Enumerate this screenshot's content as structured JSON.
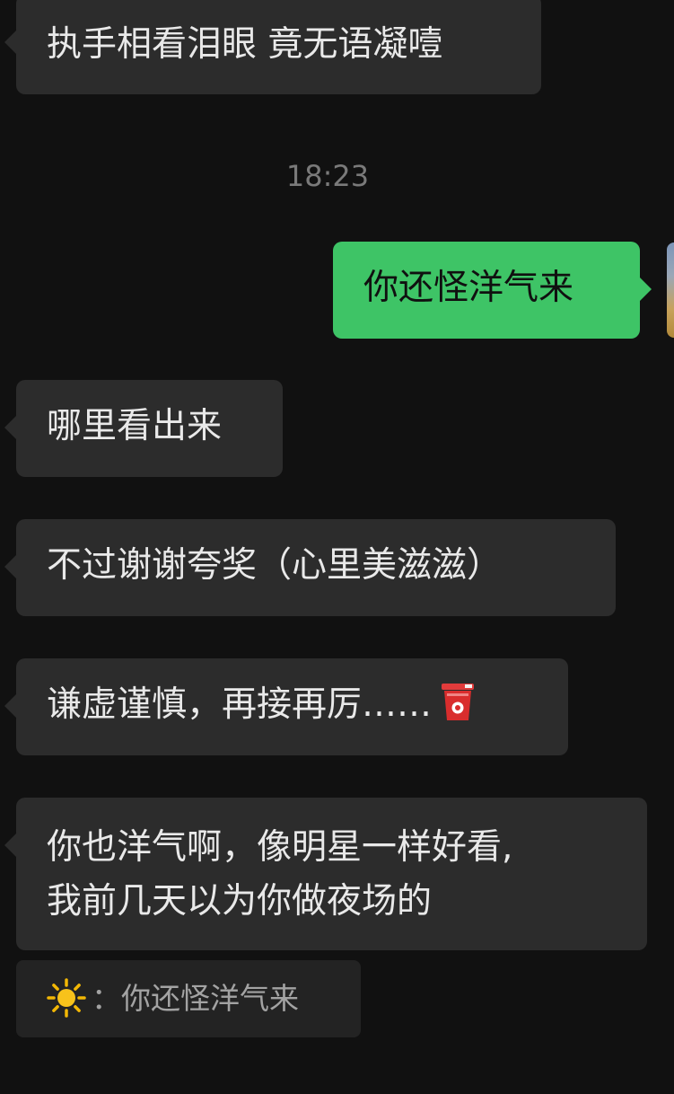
{
  "messages": [
    {
      "side": "in",
      "text": "执手相看泪眼 竟无语凝噎"
    },
    {
      "side": "out",
      "text": "你还怪洋气来"
    },
    {
      "side": "in",
      "text": "哪里看出来"
    },
    {
      "side": "in",
      "text": "不过谢谢夸奖（心里美滋滋）"
    },
    {
      "side": "in",
      "text": "谦虚谨慎，再接再厉……",
      "emoji": "red-cup-emoji"
    },
    {
      "side": "in",
      "lines": [
        "你也洋气啊，像明星一样好看,",
        "我前几天以为你做夜场的"
      ]
    }
  ],
  "timestamp": "18:23",
  "quote": {
    "icon": "sun-emoji",
    "separator": "：",
    "text": "你还怪洋气来"
  },
  "colors": {
    "background": "#111111",
    "incoming_bubble": "#2c2c2c",
    "outgoing_bubble": "#3ec466",
    "timestamp": "#7a7a7a"
  }
}
